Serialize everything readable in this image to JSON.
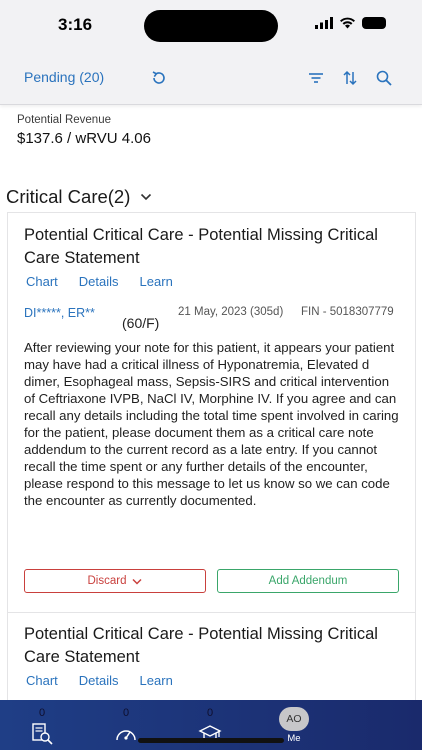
{
  "status_bar": {
    "time": "3:16"
  },
  "toolbar": {
    "pending_label": "Pending (20)"
  },
  "revenue": {
    "label": "Potential Revenue",
    "value": "$137.6 / wRVU 4.06"
  },
  "section": {
    "title": "Critical Care(2)"
  },
  "cards": [
    {
      "title": "Potential Critical Care - Potential Missing Critical Care Statement",
      "links": [
        "Chart",
        "Details",
        "Learn"
      ],
      "patient_name": "DI*****, ER**",
      "age_sex": "(60/F)",
      "date": "21 May, 2023 (305d)",
      "fin": "FIN - 5018307779",
      "message": "After reviewing your note for this patient, it appears your patient may have had a critical illness of Hyponatremia, Elevated d dimer, Esophageal mass, Sepsis-SIRS and critical intervention of Ceftriaxone IVPB, NaCl IV, Morphine IV. If you agree and can recall any details including the total time spent involved in caring for the patient, please document them as a critical care note addendum to the current record as a late entry. If you cannot recall the time spent or any further details of the encounter, please respond to this message to let us know so we can code the encounter as currently documented.",
      "discard_label": "Discard",
      "addendum_label": "Add Addendum"
    },
    {
      "title": "Potential Critical Care - Potential Missing Critical Care Statement",
      "links": [
        "Chart",
        "Details",
        "Learn"
      ]
    }
  ],
  "tabbar": {
    "tabs": [
      {
        "count": "0",
        "icon": "document-search-icon"
      },
      {
        "count": "0",
        "icon": "speedometer-icon"
      },
      {
        "count": "0",
        "icon": "graduation-cap-icon"
      },
      {
        "avatar": "AO",
        "label": "Me"
      }
    ]
  },
  "colors": {
    "accent": "#2a73bd",
    "discard": "#c9403d",
    "addendum": "#3aa66a",
    "tabbar": "#1f3e86"
  }
}
